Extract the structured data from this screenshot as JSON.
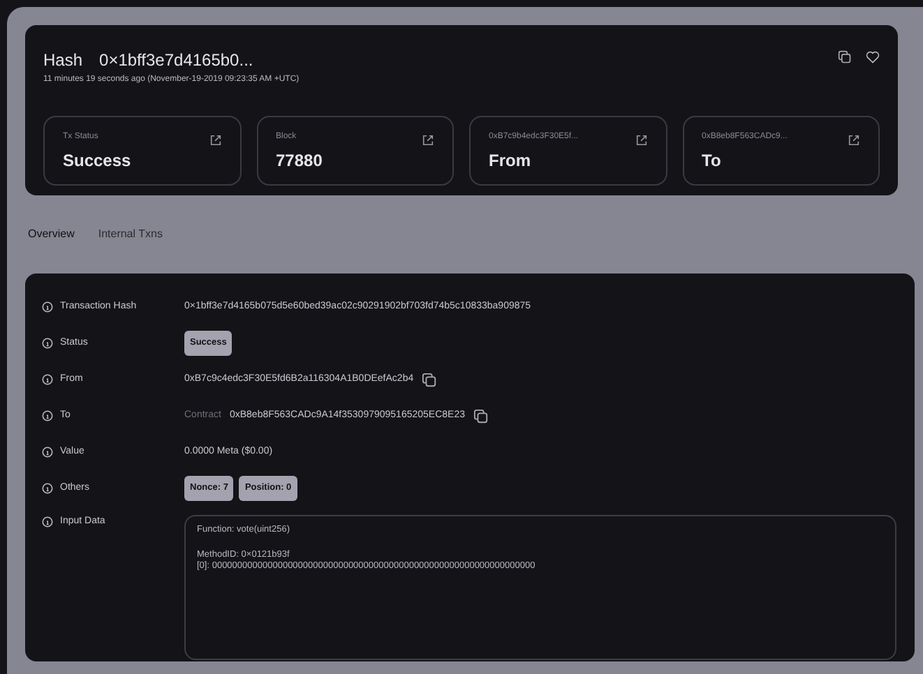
{
  "header": {
    "label": "Hash",
    "hash": "0×1bff3e7d4165b0...",
    "time": "11 minutes 19 seconds ago (November-19-2019 09:23:35 AM +UTC)"
  },
  "cards": [
    {
      "caption": "Tx Status",
      "value": "Success"
    },
    {
      "caption": "Block",
      "value": "77880"
    },
    {
      "caption": "0xB7c9b4edc3F30E5f...",
      "value": "From"
    },
    {
      "caption": "0xB8eb8F563CADc9...",
      "value": "To"
    }
  ],
  "tabs": [
    {
      "label": "Overview",
      "selected": true
    },
    {
      "label": "Internal Txns",
      "selected": false
    }
  ],
  "rows": [
    {
      "kind": "text",
      "label": "Transaction Hash",
      "value": "0×1bff3e7d4165b075d5e60bed39ac02c90291902bf703fd74b5c10833ba909875"
    },
    {
      "kind": "badges",
      "label": "Status",
      "badges": [
        "Success"
      ]
    },
    {
      "kind": "address",
      "label": "From",
      "value": "0xB7c9c4edc3F30E5fd6B2a116304A1B0DEefAc2b4"
    },
    {
      "kind": "address",
      "label": "To",
      "prefix": "Contract",
      "value": "0xB8eb8F563CADc9A14f3530979095165205EC8E23"
    },
    {
      "kind": "text",
      "label": "Value",
      "value": "0.0000 Meta ($0.00)"
    },
    {
      "kind": "badges",
      "label": "Others",
      "badges": [
        "Nonce: 7",
        "Position: 0"
      ]
    },
    {
      "kind": "input",
      "label": "Input Data",
      "paragraphs": [
        [
          "Function: vote(uint256)"
        ],
        [
          "MethodID: 0×0121b93f",
          "[0]: 0000000000000000000000000000000000000000000000000000000000000000"
        ]
      ]
    }
  ]
}
